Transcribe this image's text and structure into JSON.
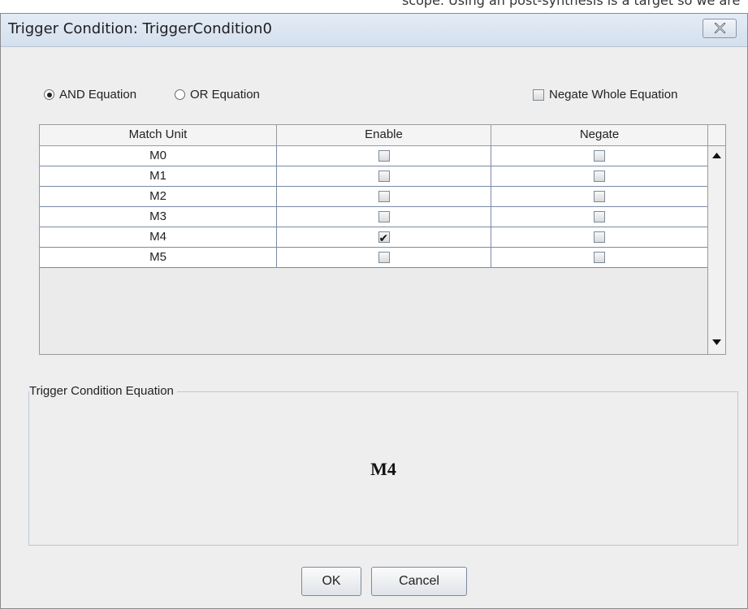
{
  "background_cutoff_text": "scope. Using an post-synthesis is a target so we are",
  "window": {
    "title": "Trigger Condition: TriggerCondition0"
  },
  "options": {
    "and_label": "AND Equation",
    "or_label": "OR Equation",
    "and_selected": true,
    "negate_whole_label": "Negate Whole Equation",
    "negate_whole_checked": false
  },
  "table": {
    "headers": [
      "Match Unit",
      "Enable",
      "Negate"
    ],
    "rows": [
      {
        "unit": "M0",
        "enable": false,
        "negate": false
      },
      {
        "unit": "M1",
        "enable": false,
        "negate": false
      },
      {
        "unit": "M2",
        "enable": false,
        "negate": false
      },
      {
        "unit": "M3",
        "enable": false,
        "negate": false
      },
      {
        "unit": "M4",
        "enable": true,
        "negate": false
      },
      {
        "unit": "M5",
        "enable": false,
        "negate": false
      }
    ]
  },
  "equation": {
    "legend": "Trigger Condition Equation",
    "value": "M4"
  },
  "buttons": {
    "ok": "OK",
    "cancel": "Cancel"
  },
  "icons": {
    "close": "close-icon",
    "scroll_up": "scroll-up-arrow-icon",
    "scroll_down": "scroll-down-arrow-icon",
    "check": "check-mark-icon"
  }
}
